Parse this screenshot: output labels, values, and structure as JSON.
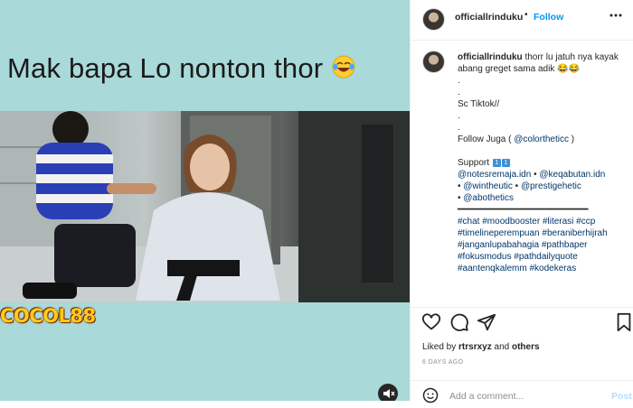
{
  "media": {
    "caption_text": "Mak bapa Lo nonton thor",
    "watermark": "COCOL88"
  },
  "header": {
    "username": "officiallrinduku",
    "separator": "•",
    "follow_label": "Follow",
    "more_icon": "more-horizontal-icon"
  },
  "caption": {
    "username": "officiallrinduku",
    "lines": [
      "thorr lu jatuh nya kayak abang greget sama adik 😂😂",
      ".",
      ".",
      "Sc Tiktok//",
      ".",
      ".",
      "Follow Juga ( ",
      "Support ",
      "━━━━━━━━━━━━━━━━━━━━━━━━"
    ],
    "follow_mention": "@colortheticc",
    "follow_suffix": " )",
    "support_badges": [
      "1",
      "1"
    ],
    "mentions": [
      "@notesremaja.idn",
      "@keqabutan.idn",
      "@wintheutic",
      "@prestigehetic",
      "@abothetics"
    ],
    "hashtags": "#chat #moodbooster #literasi #ccp #timelineperempuan #beraniberhijrah #janganlupabahagia #pathbaper #fokusmodus #pathdailyquote #aantenqkalemm #kodekeras"
  },
  "actions": {
    "liked_by_prefix": "Liked by ",
    "liked_by_user": "rtrsrxyz",
    "and": " and ",
    "others": "others",
    "time_ago": "6 DAYS AGO",
    "comment_placeholder": "Add a comment...",
    "post_label": "Post"
  },
  "colors": {
    "follow_blue": "#0095f6",
    "link_blue": "#00376b",
    "media_bg": "#a9d9d9"
  }
}
